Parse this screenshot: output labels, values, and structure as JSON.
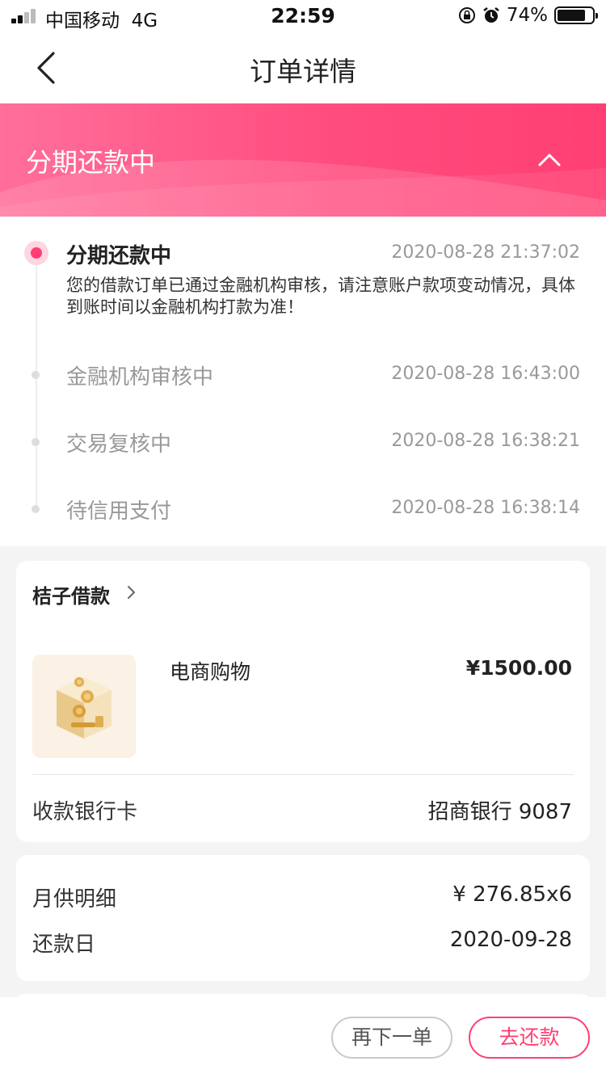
{
  "status_bar": {
    "carrier": "中国移动",
    "network": "4G",
    "time": "22:59",
    "battery": "74%",
    "battery_level": 0.74
  },
  "nav": {
    "title": "订单详情"
  },
  "banner": {
    "title": "分期还款中"
  },
  "timeline": {
    "steps": [
      {
        "label": "分期还款中",
        "time": "2020-08-28 21:37:02",
        "description": "您的借款订单已通过金融机构审核，请注意账户款项变动情况，具体到账时间以金融机构打款为准！",
        "active": true
      },
      {
        "label": "金融机构审核中",
        "time": "2020-08-28 16:43:00",
        "active": false
      },
      {
        "label": "交易复核中",
        "time": "2020-08-28 16:38:21",
        "active": false
      },
      {
        "label": "待信用支付",
        "time": "2020-08-28 16:38:14",
        "active": false
      }
    ]
  },
  "order_card": {
    "merchant": "桔子借款",
    "product_name": "电商购物",
    "price": "¥1500.00",
    "bank_label": "收款银行卡",
    "bank_value": "招商银行 9087"
  },
  "repayment_card": {
    "monthly_label": "月供明细",
    "monthly_value": "¥ 276.85x6",
    "due_label": "还款日",
    "due_value": "2020-09-28"
  },
  "buttons": {
    "reorder": "再下一单",
    "repay": "去还款"
  },
  "colors": {
    "accent": "#ff3f73",
    "banner_start": "#ff6f9a",
    "banner_end": "#ff3f73",
    "page_bg": "#f4f4f4"
  },
  "icons": [
    "signal-icon",
    "rotation-lock-icon",
    "alarm-icon",
    "battery-icon",
    "back-arrow-icon",
    "chevron-up-icon",
    "chevron-right-icon",
    "coin-box-icon"
  ]
}
